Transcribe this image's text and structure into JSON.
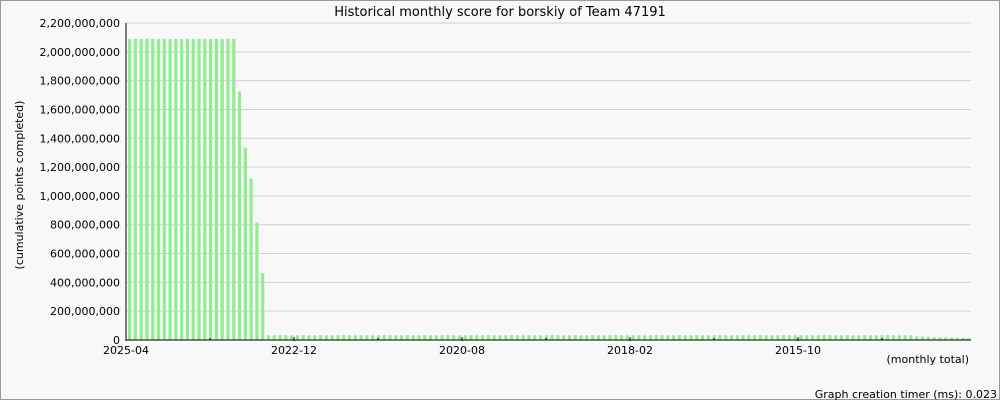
{
  "chart_data": {
    "type": "bar",
    "title": "Historical monthly score for borskiy of Team 47191",
    "ylabel": "(cumulative points completed)",
    "xlabel": "(monthly total)",
    "ylim": [
      0,
      2200000000
    ],
    "y_ticks": [
      "0",
      "200,000,000",
      "400,000,000",
      "600,000,000",
      "800,000,000",
      "1,000,000,000",
      "1,200,000,000",
      "1,400,000,000",
      "1,600,000,000",
      "1,800,000,000",
      "2,000,000,000",
      "2,200,000,000"
    ],
    "x_tick_labels": [
      "2025-04",
      "2022-12",
      "2020-08",
      "2018-02",
      "2015-10"
    ],
    "grid": true,
    "bar_color": "#90ee90",
    "series": [
      {
        "values": [
          2090000000,
          2090000000,
          2090000000,
          2090000000,
          2090000000,
          2090000000,
          2090000000,
          2090000000,
          2090000000,
          2090000000,
          2090000000,
          2090000000,
          2090000000,
          2090000000,
          2090000000,
          2090000000,
          2090000000,
          2090000000,
          2090000000,
          1725000000,
          1335000000,
          1120000000,
          815000000,
          465000000,
          33000000,
          33000000,
          33000000,
          33000000,
          33000000,
          33000000,
          33000000,
          33000000,
          33000000,
          33000000,
          33000000,
          33000000,
          33000000,
          33000000,
          33000000,
          33000000,
          33000000,
          33000000,
          33000000,
          33000000,
          33000000,
          33000000,
          33000000,
          33000000,
          33000000,
          33000000,
          33000000,
          33000000,
          33000000,
          33000000,
          33000000,
          33000000,
          33000000,
          33000000,
          33000000,
          33000000,
          33000000,
          33000000,
          33000000,
          33000000,
          33000000,
          33000000,
          33000000,
          33000000,
          33000000,
          33000000,
          33000000,
          33000000,
          33000000,
          33000000,
          33000000,
          33000000,
          33000000,
          33000000,
          33000000,
          33000000,
          33000000,
          33000000,
          33000000,
          33000000,
          33000000,
          33000000,
          33000000,
          33000000,
          33000000,
          33000000,
          33000000,
          33000000,
          33000000,
          33000000,
          33000000,
          33000000,
          33000000,
          33000000,
          33000000,
          33000000,
          33000000,
          33000000,
          33000000,
          33000000,
          33000000,
          33000000,
          33000000,
          33000000,
          33000000,
          33000000,
          33000000,
          33000000,
          33000000,
          33000000,
          33000000,
          33000000,
          33000000,
          33000000,
          33000000,
          33000000,
          33000000,
          33000000,
          33000000,
          33000000,
          33000000,
          33000000,
          33000000,
          33000000,
          33000000,
          33000000,
          33000000,
          33000000,
          33000000,
          33000000,
          33000000,
          33000000,
          26000000,
          24000000,
          22000000,
          20000000,
          19000000,
          18000000,
          17000000,
          16000000,
          15000000,
          14000000
        ]
      }
    ]
  },
  "footer": {
    "timer_text": "Graph creation timer (ms): 0.023"
  }
}
